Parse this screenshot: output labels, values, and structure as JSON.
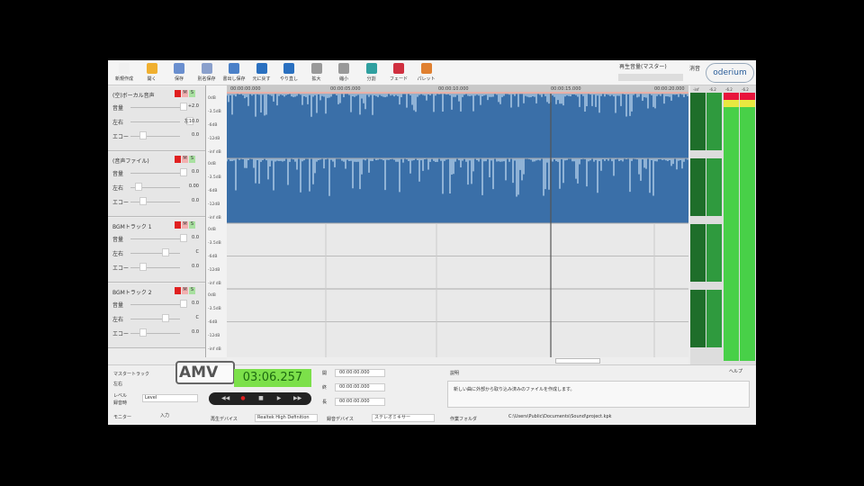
{
  "toolbar": {
    "items": [
      {
        "label": "新規作成",
        "icon": "new-file-icon",
        "color": "#f0f0f0"
      },
      {
        "label": "開く",
        "icon": "open-folder-icon",
        "color": "#f0b030"
      },
      {
        "label": "保存",
        "icon": "save-icon",
        "color": "#6a8fcf"
      },
      {
        "label": "別名保存",
        "icon": "save-as-icon",
        "color": "#8aa0cc"
      },
      {
        "label": "書出し保存",
        "icon": "export-icon",
        "color": "#4a80c8"
      },
      {
        "label": "元に戻す",
        "icon": "undo-icon",
        "color": "#2a70c0"
      },
      {
        "label": "やり直し",
        "icon": "redo-icon",
        "color": "#2a70c0"
      },
      {
        "label": "拡大",
        "icon": "zoom-in-icon",
        "color": "#999999"
      },
      {
        "label": "縮小",
        "icon": "zoom-out-icon",
        "color": "#999999"
      },
      {
        "label": "分割",
        "icon": "split-icon",
        "color": "#30a0a0"
      },
      {
        "label": "フェード",
        "icon": "fade-icon",
        "color": "#d03040"
      },
      {
        "label": "パレット",
        "icon": "palette-icon",
        "color": "#e08030"
      }
    ],
    "volume_label": "再生音量(マスター)",
    "logo": "oderium",
    "mute": "消音"
  },
  "tracks": [
    {
      "name": "(空)ボーカル音声",
      "rows": [
        {
          "k": "音量",
          "v": "+2.0"
        },
        {
          "k": "左右",
          "v": "左10.0"
        },
        {
          "k": "エコー",
          "v": "0.0"
        }
      ]
    },
    {
      "name": "(音声ファイル)",
      "rows": [
        {
          "k": "音量",
          "v": "0.0"
        },
        {
          "k": "左右",
          "v": "0.00"
        },
        {
          "k": "エコー",
          "v": "0.0"
        }
      ]
    },
    {
      "name": "BGMトラック 1",
      "rows": [
        {
          "k": "音量",
          "v": "0.0"
        },
        {
          "k": "左右",
          "v": "C"
        },
        {
          "k": "エコー",
          "v": "0.0"
        }
      ]
    },
    {
      "name": "BGMトラック 2",
      "rows": [
        {
          "k": "音量",
          "v": "0.0"
        },
        {
          "k": "左右",
          "v": "C"
        },
        {
          "k": "エコー",
          "v": "0.0"
        }
      ]
    }
  ],
  "track_buttons": [
    "M",
    "S"
  ],
  "axis_labels": [
    "0dB",
    "-3.5dB",
    "-6dB",
    "-12dB",
    "-inf dB"
  ],
  "ruler": [
    "00:00:00.000",
    "00:00:05.000",
    "00:00:10.000",
    "00:00:15.000",
    "00:00:20.000"
  ],
  "meters": {
    "top_labels": [
      "-inf",
      "-6.2",
      "-6.2",
      "-6.2"
    ],
    "ticks": [
      "-24",
      "-48",
      "-72"
    ],
    "channels": [
      "1",
      "2"
    ]
  },
  "bottom": {
    "master_track": "マスタートラック",
    "pan": "左右",
    "level_label": "レベル",
    "level_value": "Level",
    "record_label": "録音時",
    "monitor": "モニター",
    "input": "入力",
    "amv": "AMV",
    "timecode": "03:06.257",
    "transport": [
      "◀◀",
      "●",
      "■",
      "▶",
      "▶▶"
    ],
    "times": [
      {
        "k": "開",
        "v": "00:00:00.000"
      },
      {
        "k": "終",
        "v": "00:00:00.000"
      },
      {
        "k": "長",
        "v": "00:00:00.000"
      }
    ],
    "comment_label": "説明",
    "comment": "新しい曲に外部から取り込み済みのファイルを作成します。",
    "help": "ヘルプ",
    "playback_device_label": "再生デバイス",
    "playback_device": "Realtek High Definition",
    "record_device_label": "録音デバイス",
    "record_device": "ステレオミキサー",
    "save_folder_label": "作業フォルダ",
    "save_folder": "C:\\Users\\Public\\Documents\\Sound\\project.kpk"
  }
}
